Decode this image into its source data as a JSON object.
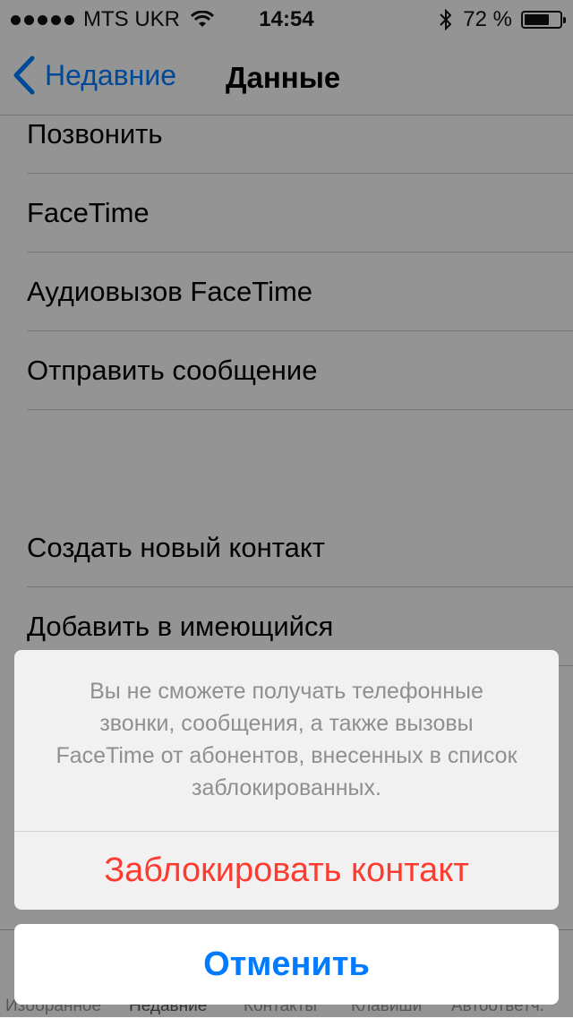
{
  "status_bar": {
    "carrier": "MTS UKR",
    "time": "14:54",
    "battery_text": "72 %",
    "battery_level": 0.72,
    "icons": [
      "signal-dots",
      "wifi-icon",
      "bluetooth-icon",
      "battery-icon"
    ]
  },
  "nav": {
    "back_label": "Недавние",
    "title": "Данные"
  },
  "cells": {
    "call": "Позвонить",
    "facetime": "FaceTime",
    "facetime_audio": "Аудиовызов FaceTime",
    "send_message": "Отправить сообщение",
    "create_contact": "Создать новый контакт",
    "add_existing": "Добавить в имеющийся"
  },
  "tabbar": {
    "items": [
      "Изoбранное",
      "Недавние",
      "Контакты",
      "Клавиши",
      "Автоответч."
    ]
  },
  "action_sheet": {
    "message": "Вы не сможете получать телефонные звонки, сообщения, а также вызовы FaceTime от абонентов, внесенных в список заблокированных.",
    "destructive_label": "Заблокировать контакт",
    "cancel_label": "Отменить"
  },
  "colors": {
    "accent": "#007aff",
    "destructive": "#ff3b30"
  }
}
